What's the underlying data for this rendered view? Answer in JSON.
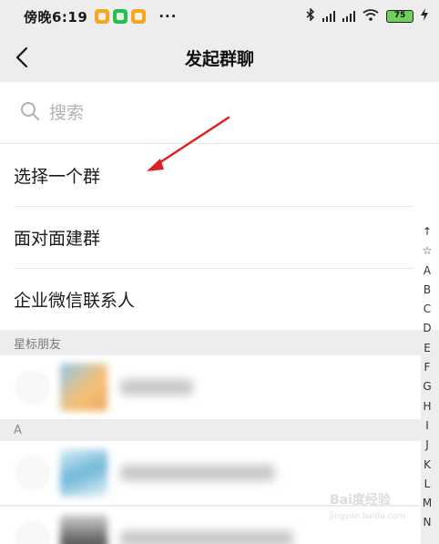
{
  "status_bar": {
    "time": "傍晚6:19",
    "more": "···",
    "battery": "75"
  },
  "header": {
    "title": "发起群聊"
  },
  "search": {
    "placeholder": "搜索"
  },
  "actions": [
    {
      "label": "选择一个群"
    },
    {
      "label": "面对面建群"
    },
    {
      "label": "企业微信联系人"
    }
  ],
  "sections": {
    "starred": "星标朋友",
    "a": "A"
  },
  "alphabet_index": [
    "↑",
    "☆",
    "A",
    "B",
    "C",
    "D",
    "E",
    "F",
    "G",
    "H",
    "I",
    "J",
    "K",
    "L",
    "M",
    "N"
  ],
  "watermark": {
    "text": "Bai度经验",
    "subtext": "jingyan.baidu.com"
  },
  "colors": {
    "accent_arrow": "#e02020",
    "background": "#ededed",
    "battery": "#6fd15a"
  }
}
